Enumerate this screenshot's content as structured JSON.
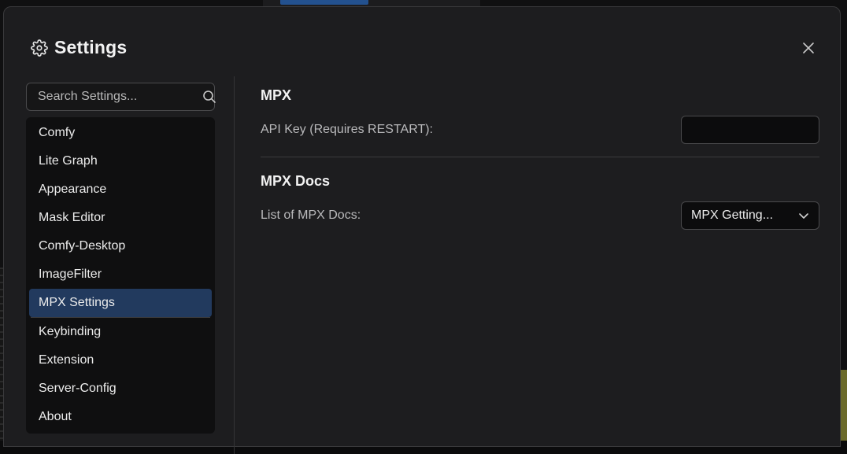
{
  "dialog": {
    "title": "Settings",
    "title_icon": "gear-icon",
    "close_icon": "close-icon"
  },
  "search": {
    "placeholder": "Search Settings...",
    "value": "",
    "icon": "search-icon"
  },
  "sidebar": {
    "active_index": 6,
    "active_color": "#223a5e",
    "items": [
      {
        "label": "Comfy"
      },
      {
        "label": "Lite Graph"
      },
      {
        "label": "Appearance"
      },
      {
        "label": "Mask Editor"
      },
      {
        "label": "Comfy-Desktop"
      },
      {
        "label": "ImageFilter"
      },
      {
        "label": "MPX Settings"
      },
      {
        "label": "Keybinding"
      },
      {
        "label": "Extension"
      },
      {
        "label": "Server-Config"
      },
      {
        "label": "About"
      }
    ]
  },
  "main": {
    "sections": [
      {
        "title": "MPX",
        "setting": {
          "label": "API Key (Requires RESTART):",
          "value": ""
        }
      },
      {
        "title": "MPX Docs",
        "setting": {
          "label": "List of MPX Docs:",
          "selected": "MPX Getting...",
          "icon": "chevron-down-icon"
        }
      }
    ]
  }
}
